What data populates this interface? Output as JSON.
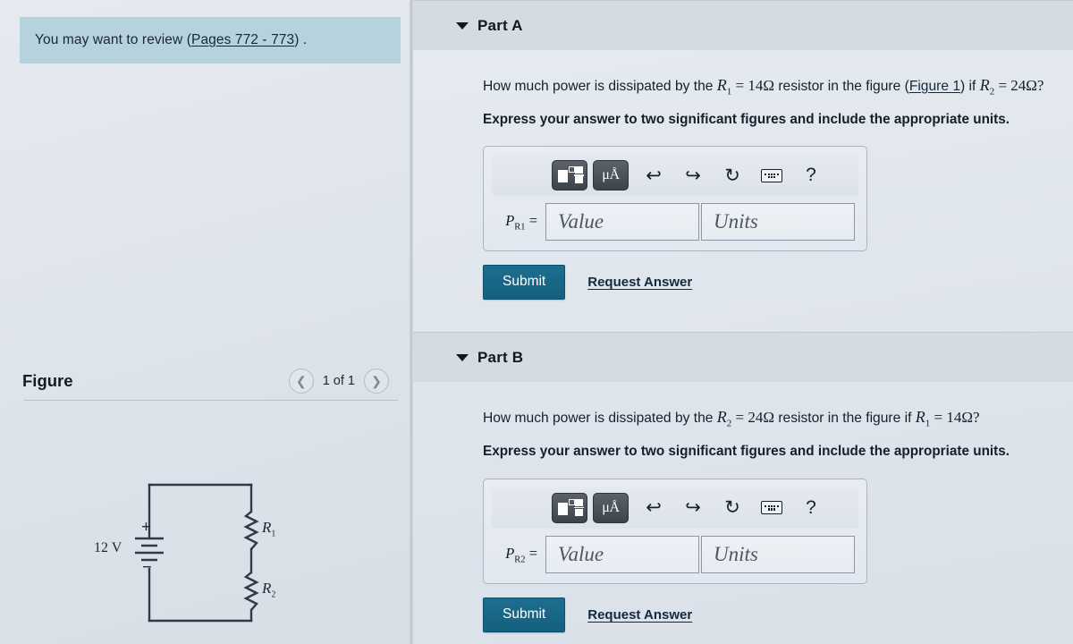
{
  "left": {
    "review": {
      "prefix": "You may want to review (",
      "link": "Pages 772 - 773",
      "suffix": ") ."
    },
    "figure": {
      "title": "Figure",
      "count": "1 of 1",
      "prev_icon": "chevron-left-icon",
      "next_icon": "chevron-right-icon"
    },
    "circuit": {
      "voltage_label": "12 V",
      "plus_label": "+",
      "minus_label": "−",
      "r1_label": "R",
      "r1_sub": "1",
      "r2_label": "R",
      "r2_sub": "2",
      "stroke_color": "#2d3a47"
    }
  },
  "parts": [
    {
      "id": "part-a",
      "title": "Part A",
      "collapse_icon": "triangle-down-icon",
      "question": {
        "seg1": "How much power is dissipated by the ",
        "var1": "R",
        "var1_sub": "1",
        "eq1": " = ",
        "val1": "14Ω",
        "seg2": " resistor in the figure (",
        "link": "Figure 1",
        "seg3": ") if ",
        "var2": "R",
        "var2_sub": "2",
        "eq2": " = ",
        "val2": "24Ω?"
      },
      "instruction": "Express your answer to two significant figures and include the appropriate units.",
      "toolbar": {
        "template_icon": "math-template-icon",
        "units_label": "μÅ",
        "undo_icon": "undo-arrow-icon",
        "redo_icon": "redo-arrow-icon",
        "reset_icon": "reset-circle-icon",
        "keyboard_icon": "keyboard-icon",
        "help_label": "?"
      },
      "answer": {
        "prefix": "P",
        "prefix_sub": "R1",
        "prefix_eq": " =",
        "value_placeholder": "Value",
        "units_placeholder": "Units"
      },
      "submit_label": "Submit",
      "request_label": "Request Answer"
    },
    {
      "id": "part-b",
      "title": "Part B",
      "collapse_icon": "triangle-down-icon",
      "question": {
        "seg1": "How much power is dissipated by the ",
        "var1": "R",
        "var1_sub": "2",
        "eq1": " = ",
        "val1": "24Ω",
        "seg2": " resistor in the figure if ",
        "link": "",
        "seg3": "",
        "var2": "R",
        "var2_sub": "1",
        "eq2": " = ",
        "val2": "14Ω?"
      },
      "instruction": "Express your answer to two significant figures and include the appropriate units.",
      "toolbar": {
        "template_icon": "math-template-icon",
        "units_label": "μÅ",
        "undo_icon": "undo-arrow-icon",
        "redo_icon": "redo-arrow-icon",
        "reset_icon": "reset-circle-icon",
        "keyboard_icon": "keyboard-icon",
        "help_label": "?"
      },
      "answer": {
        "prefix": "P",
        "prefix_sub": "R2",
        "prefix_eq": " =",
        "value_placeholder": "Value",
        "units_placeholder": "Units"
      },
      "submit_label": "Submit",
      "request_label": "Request Answer"
    }
  ],
  "colors": {
    "banner": "#b6d2dd",
    "submit": "#15607e",
    "link": "#16283c",
    "header_bar": "#d5dbe3"
  }
}
